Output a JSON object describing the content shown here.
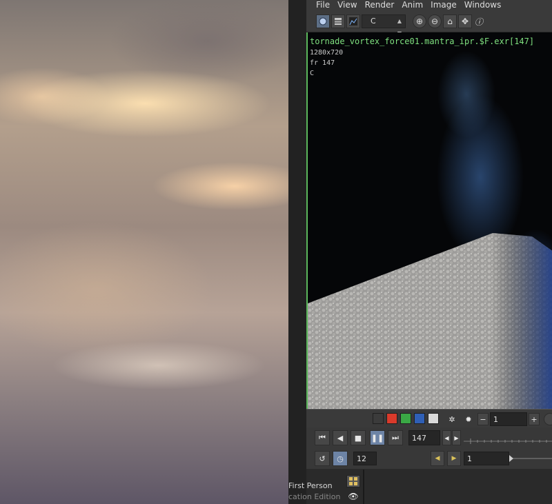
{
  "menu": [
    "File",
    "View",
    "Render",
    "Anim",
    "Image",
    "Windows"
  ],
  "toolbar": {
    "plane": "C",
    "icons": [
      "view-mode-icon",
      "layers-icon",
      "histogram-icon",
      "zoom-in-icon",
      "zoom-out-icon",
      "home-icon",
      "fit-icon",
      "info-icon"
    ]
  },
  "viewport": {
    "image_name": "tornade_vortex_force01.mantra_ipr.$F.exr[147]",
    "resolution": "1280x720",
    "frame": "fr 147",
    "plane": "C"
  },
  "channels": {
    "colors": [
      "#3b3b3b",
      "#d93a2b",
      "#3aa845",
      "#2f5fb5",
      "#d9d9d9"
    ],
    "step_value": "1"
  },
  "playback": {
    "frame_value": "147",
    "fps_value": "12",
    "range_value": "1"
  },
  "desktop": {
    "first_person": "First Person",
    "edition": "cation Edition"
  },
  "colors": {
    "accent_green": "#5cb85c",
    "panel_bg": "#3a3a3a"
  }
}
